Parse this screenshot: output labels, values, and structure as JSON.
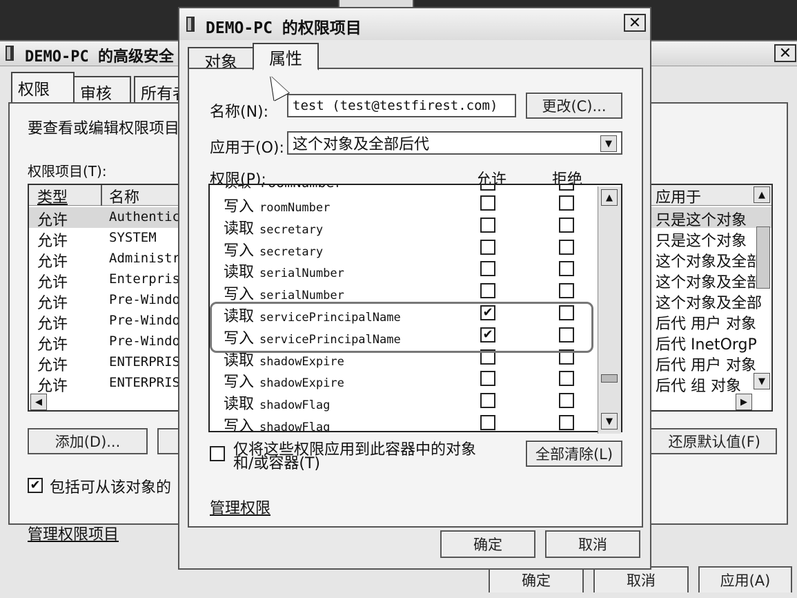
{
  "background_window": {
    "title": "DEMO-PC 的高级安全",
    "tabs": [
      "权限",
      "审核",
      "所有者"
    ],
    "instruction": "要查看或编辑权限项目",
    "list_label": "权限项目(T):",
    "columns": {
      "type": "类型",
      "name": "名称",
      "applies_to": "应用于"
    },
    "rows": [
      {
        "type": "允许",
        "name": "Authentic",
        "applies": "只是这个对象"
      },
      {
        "type": "允许",
        "name": "SYSTEM",
        "applies": "只是这个对象"
      },
      {
        "type": "允许",
        "name": "Administr",
        "applies": "这个对象及全部"
      },
      {
        "type": "允许",
        "name": "Enterpris",
        "applies": "这个对象及全部"
      },
      {
        "type": "允许",
        "name": "Pre-Windo",
        "applies": "这个对象及全部"
      },
      {
        "type": "允许",
        "name": "Pre-Windo",
        "applies": "后代 用户 对象"
      },
      {
        "type": "允许",
        "name": "Pre-Windo",
        "applies": "后代 InetOrgP"
      },
      {
        "type": "允许",
        "name": "ENTERPRIS",
        "applies": "后代 用户 对象"
      },
      {
        "type": "允许",
        "name": "ENTERPRIS",
        "applies": "后代 组 对象"
      }
    ],
    "add_button": "添加(D)...",
    "restore_button": "还原默认值(F)",
    "include_checkbox": "包括可从该对象的",
    "manage_link": "管理权限项目",
    "ok": "确定",
    "cancel": "取消",
    "apply": "应用(A)"
  },
  "dialog": {
    "title": "DEMO-PC 的权限项目",
    "close": "✕",
    "tabs": {
      "object": "对象",
      "properties": "属性"
    },
    "name_label": "名称(N):",
    "name_value": "test (test@testfirest.com)",
    "change_button": "更改(C)...",
    "apply_to_label": "应用于(O):",
    "apply_to_value": "这个对象及全部后代",
    "perm_label": "权限(P):",
    "allow_header": "允许",
    "deny_header": "拒绝",
    "permissions": [
      {
        "action": "读取",
        "attr": "roomNumber",
        "allow": "",
        "deny": ""
      },
      {
        "action": "写入",
        "attr": "roomNumber",
        "allow": "",
        "deny": ""
      },
      {
        "action": "读取",
        "attr": "secretary",
        "allow": "",
        "deny": ""
      },
      {
        "action": "写入",
        "attr": "secretary",
        "allow": "",
        "deny": ""
      },
      {
        "action": "读取",
        "attr": "serialNumber",
        "allow": "",
        "deny": ""
      },
      {
        "action": "写入",
        "attr": "serialNumber",
        "allow": "",
        "deny": ""
      },
      {
        "action": "读取",
        "attr": "servicePrincipalName",
        "allow": "✔",
        "deny": ""
      },
      {
        "action": "写入",
        "attr": "servicePrincipalName",
        "allow": "✔",
        "deny": ""
      },
      {
        "action": "读取",
        "attr": "shadowExpire",
        "allow": "",
        "deny": ""
      },
      {
        "action": "写入",
        "attr": "shadowExpire",
        "allow": "",
        "deny": ""
      },
      {
        "action": "读取",
        "attr": "shadowFlag",
        "allow": "",
        "deny": ""
      },
      {
        "action": "写入",
        "attr": "shadowFlag",
        "allow": "",
        "deny": ""
      }
    ],
    "apply_only_line1": "仅将这些权限应用到此容器中的对象",
    "apply_only_line2": "和/或容器(T)",
    "clear_all": "全部清除(L)",
    "manage_link": "管理权限",
    "ok": "确定",
    "cancel": "取消"
  }
}
